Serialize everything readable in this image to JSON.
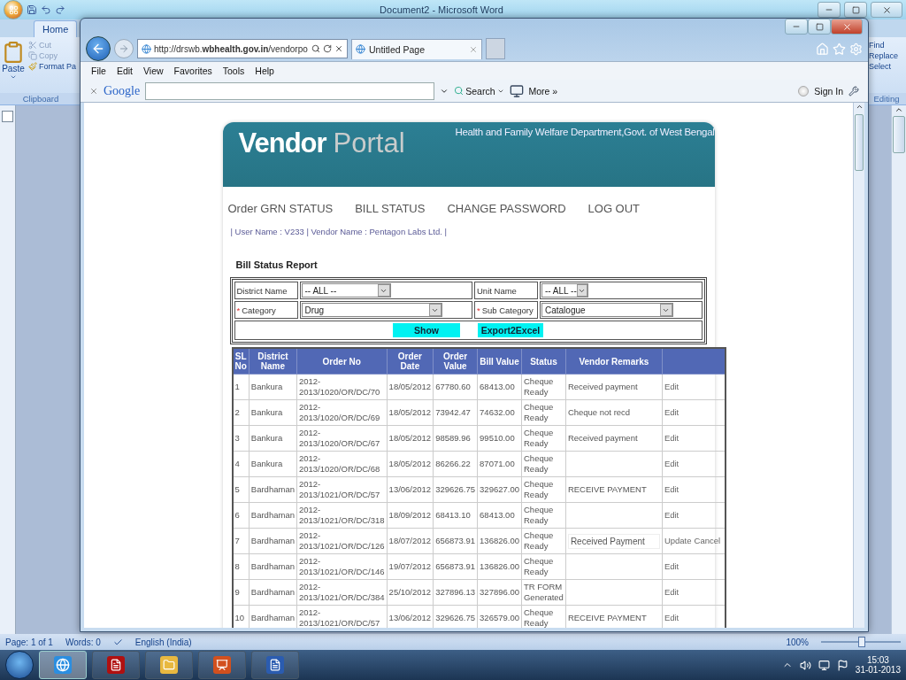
{
  "word": {
    "title": "Document2 - Microsoft Word",
    "tabs": [
      {
        "label": "Home",
        "selected": true
      }
    ],
    "clipboard": {
      "paste": "Paste",
      "cut": "Cut",
      "copy": "Copy",
      "format_painter": "Format Pa",
      "group": "Clipboard"
    },
    "editing": {
      "find": "Find",
      "replace": "Replace",
      "select": "Select",
      "group": "Editing"
    },
    "status_bar": {
      "page": "Page: 1 of 1",
      "words": "Words: 0",
      "language": "English (India)",
      "zoom": "100%",
      "zoom_slider": {
        "level": 0.5
      }
    }
  },
  "browser": {
    "address": "http://drswb.**wbhealth.gov.in**/vendorpo",
    "tab": "Untitled Page",
    "menu": [
      "File",
      "Edit",
      "View",
      "Favorites",
      "Tools",
      "Help"
    ],
    "google": {
      "logo": "Google",
      "search_button": "Search",
      "more": "More »",
      "sign_in": "Sign In"
    }
  },
  "portal": {
    "brand": {
      "primary": "Vendor",
      "secondary": "Portal"
    },
    "department": "Health and Family Welfare Department,Govt. of West Bengal",
    "nav": [
      "Order GRN STATUS",
      "BILL STATUS",
      "CHANGE PASSWORD",
      "LOG OUT"
    ],
    "user_line": "| User Name : V233 | Vendor Name : Pentagon Labs Ltd. |",
    "report_title": "Bill Status Report",
    "filters": [
      {
        "label": "District Name",
        "required": false,
        "value": "-- ALL --"
      },
      {
        "label": "Unit Name",
        "required": false,
        "value": "-- ALL --"
      },
      {
        "label": "Category",
        "required": true,
        "required_mark": "*",
        "value": "Drug"
      },
      {
        "label": "Sub Category",
        "required": true,
        "required_mark": "*",
        "value": "Catalogue"
      }
    ],
    "buttons": [
      "Show",
      "Export2Excel"
    ],
    "columns": [
      "SL No",
      "District Name",
      "Order No",
      "Order Date",
      "Order Value",
      "Bill Value",
      "Status",
      "Vendor Remarks"
    ],
    "rows": [
      {
        "sl": "1",
        "district": "Bankura",
        "order_no": "2012-2013/1020/OR/DC/70",
        "order_date": "18/05/2012",
        "order_value": "67780.60",
        "bill_value": "68413.00",
        "status": "Cheque Ready",
        "remarks": "Received payment",
        "editing": false,
        "actions": [
          "Edit"
        ]
      },
      {
        "sl": "2",
        "district": "Bankura",
        "order_no": "2012-2013/1020/OR/DC/69",
        "order_date": "18/05/2012",
        "order_value": "73942.47",
        "bill_value": "74632.00",
        "status": "Cheque Ready",
        "remarks": "Cheque not recd",
        "editing": false,
        "actions": [
          "Edit"
        ]
      },
      {
        "sl": "3",
        "district": "Bankura",
        "order_no": "2012-2013/1020/OR/DC/67",
        "order_date": "18/05/2012",
        "order_value": "98589.96",
        "bill_value": "99510.00",
        "status": "Cheque Ready",
        "remarks": "Received payment",
        "editing": false,
        "actions": [
          "Edit"
        ]
      },
      {
        "sl": "4",
        "district": "Bankura",
        "order_no": "2012-2013/1020/OR/DC/68",
        "order_date": "18/05/2012",
        "order_value": "86266.22",
        "bill_value": "87071.00",
        "status": "Cheque Ready",
        "editing": false,
        "actions": [
          "Edit"
        ]
      },
      {
        "sl": "5",
        "district": "Bardhaman",
        "order_no": "2012-2013/1021/OR/DC/57",
        "order_date": "13/06/2012",
        "order_value": "329626.75",
        "bill_value": "329627.00",
        "status": "Cheque Ready",
        "remarks": "RECEIVE PAYMENT",
        "editing": false,
        "actions": [
          "Edit"
        ]
      },
      {
        "sl": "6",
        "district": "Bardhaman",
        "order_no": "2012-2013/1021/OR/DC/318",
        "order_date": "18/09/2012",
        "order_value": "68413.10",
        "bill_value": "68413.00",
        "status": "Cheque Ready",
        "editing": false,
        "actions": [
          "Edit"
        ]
      },
      {
        "sl": "7",
        "district": "Bardhaman",
        "order_no": "2012-2013/1021/OR/DC/126",
        "order_date": "18/07/2012",
        "order_value": "656873.91",
        "bill_value": "136826.00",
        "status": "Cheque Ready",
        "remarks": "Received Payment",
        "editing": true,
        "actions": [
          "Update",
          "Cancel"
        ]
      },
      {
        "sl": "8",
        "district": "Bardhaman",
        "order_no": "2012-2013/1021/OR/DC/146",
        "order_date": "19/07/2012",
        "order_value": "656873.91",
        "bill_value": "136826.00",
        "status": "Cheque Ready",
        "editing": false,
        "actions": [
          "Edit"
        ]
      },
      {
        "sl": "9",
        "district": "Bardhaman",
        "order_no": "2012-2013/1021/OR/DC/384",
        "order_date": "25/10/2012",
        "order_value": "327896.13",
        "bill_value": "327896.00",
        "status": "TR FORM Generated",
        "editing": false,
        "actions": [
          "Edit"
        ]
      },
      {
        "sl": "10",
        "district": "Bardhaman",
        "order_no": "2012-2013/1021/OR/DC/57",
        "order_date": "13/06/2012",
        "order_value": "329626.75",
        "bill_value": "326579.00",
        "status": "Cheque Ready",
        "remarks": "RECEIVE PAYMENT",
        "editing": false,
        "actions": [
          "Edit"
        ]
      }
    ]
  },
  "taskbar": {
    "apps": [
      {
        "kind": "browser",
        "active": true
      },
      {
        "kind": "pdf",
        "active": false
      },
      {
        "kind": "folder",
        "active": false
      },
      {
        "kind": "slides",
        "active": false
      },
      {
        "kind": "word",
        "active": false
      }
    ],
    "time": "15:03",
    "date": "31-01-2013"
  }
}
